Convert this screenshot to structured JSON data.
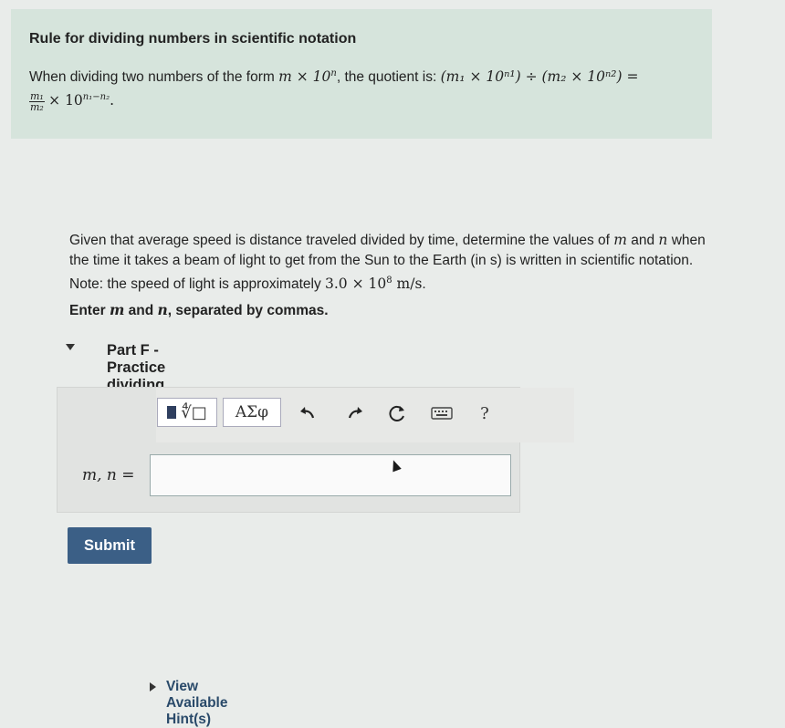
{
  "rule": {
    "title": "Rule for dividing numbers in scientific notation",
    "text_before": "When dividing two numbers of the form ",
    "form": "m × 10",
    "form_exp": "n",
    "text_mid": ", the quotient is: ",
    "quotient_expr": "(m₁ × 10ⁿ¹) ÷ (m₂ × 10ⁿ²) =",
    "frac_num": "m₁",
    "frac_den": "m₂",
    "result_base": "× 10",
    "result_exp": "n₁−n₂",
    "result_end": "."
  },
  "part": {
    "title": "Part F - Practice dividing numbers in scientific notation"
  },
  "question": {
    "text_1": "Given that average speed is distance traveled divided by time, determine the values of ",
    "m": "m",
    "and": " and",
    "n": "n",
    "text_2": " when the time it takes a beam of light to get from the Sun to the Earth (in s) is written in scientific notation. Note: the speed of light is approximately ",
    "speed_base": "3.0 × 10",
    "speed_exp": "8",
    "speed_unit": " m/s",
    "end": "."
  },
  "instruction": {
    "prefix": "Enter ",
    "m": "m",
    "mid": " and ",
    "n": "n",
    "suffix": ", separated by commas."
  },
  "hint": {
    "label": "View Available Hint(s)"
  },
  "toolbar": {
    "templates_glyph": "∜□",
    "greek_label": "ΑΣφ",
    "help_label": "?"
  },
  "answer": {
    "label": "m, n",
    "equals": "=",
    "value": ""
  },
  "submit": {
    "label": "Submit"
  },
  "colors": {
    "submit_bg": "#3b5f86",
    "rule_bg": "#d6e4dc",
    "hint_text": "#2a4a6a"
  }
}
